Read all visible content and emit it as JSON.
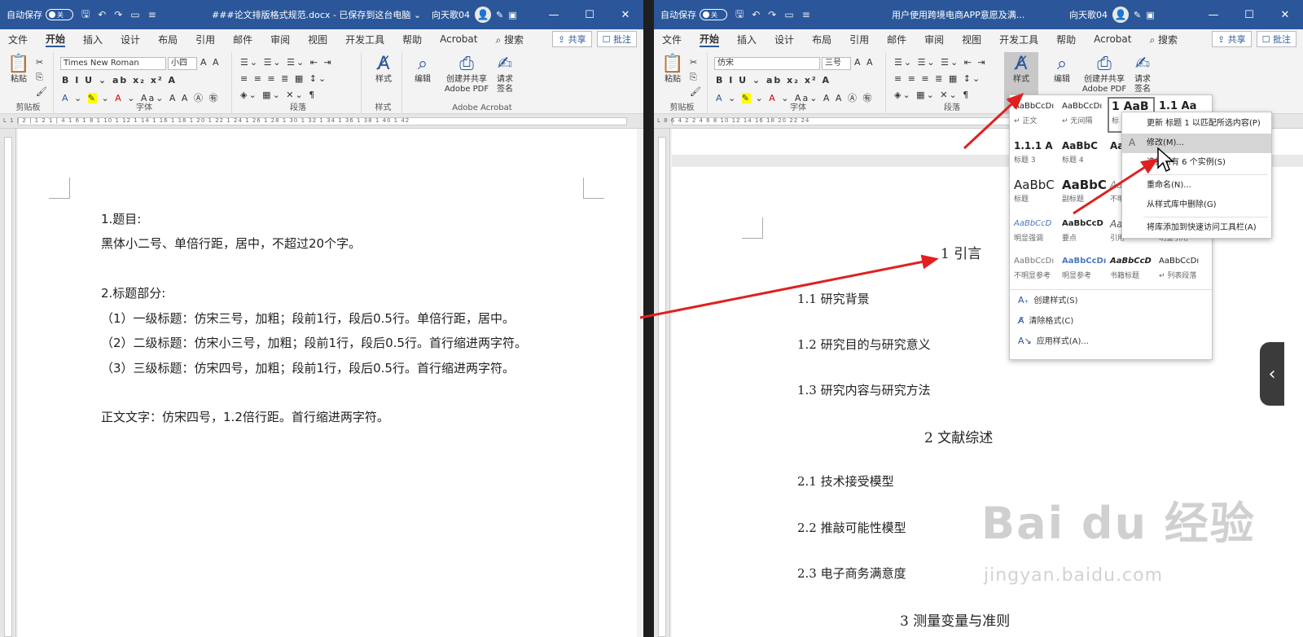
{
  "left_window": {
    "autosave_label": "自动保存",
    "autosave_state": "关",
    "doc_title": "###论文排版格式规范.docx - 已保存到这台电脑 ⌄",
    "user_name": "向天歌04",
    "tabs": [
      "文件",
      "开始",
      "插入",
      "设计",
      "布局",
      "引用",
      "邮件",
      "审阅",
      "视图",
      "开发工具",
      "帮助",
      "Acrobat",
      "⌕ 搜索"
    ],
    "share_label": "⇪ 共享",
    "comment_label": "☐ 批注",
    "ribbon": {
      "paste_label": "粘贴",
      "clipboard_label": "剪贴板",
      "font_name": "Times New Roman",
      "font_size": "小四",
      "font_label": "字体",
      "paragraph_label": "段落",
      "styles_btn_label": "样式",
      "styles_group_label": "样式",
      "edit_label": "编辑",
      "pdf_label": "创建并共享 Adobe PDF",
      "sign_label": "请求 签名",
      "acrobat_group_label": "Adobe Acrobat"
    },
    "ruler_marks": "L  1 | 2 | 1   2   1 | 4   1 6   1 8   1 10   1 12   1 14   1 16   1 18   1 20   1 22   1 24   1 26   1 28   1 30   1 32   1 34   1 36   1 38   1 40   1 42",
    "content": [
      "1.题目:",
      "黑体小二号、单倍行距，居中，不超过20个字。",
      "2.标题部分:",
      "（1）一级标题：仿宋三号，加粗；段前1行，段后0.5行。单倍行距，居中。",
      "（2）二级标题：仿宋小三号，加粗；段前1行，段后0.5行。首行缩进两字符。",
      "（3）三级标题：仿宋四号，加粗；段前1行，段后0.5行。首行缩进两字符。",
      "正文文字：仿宋四号，1.2倍行距。首行缩进两字符。"
    ]
  },
  "right_window": {
    "autosave_label": "自动保存",
    "autosave_state": "关",
    "doc_title": "用户使用跨境电商APP意愿及满...",
    "user_name": "向天歌04",
    "tabs": [
      "文件",
      "开始",
      "插入",
      "设计",
      "布局",
      "引用",
      "邮件",
      "审阅",
      "视图",
      "开发工具",
      "帮助",
      "Acrobat",
      "⌕ 搜索"
    ],
    "share_label": "⇪ 共享",
    "comment_label": "☐ 批注",
    "ribbon": {
      "paste_label": "粘贴",
      "clipboard_label": "剪贴板",
      "font_name": "仿宋",
      "font_size": "三号",
      "font_label": "字体",
      "paragraph_label": "段落",
      "styles_btn_label": "样式",
      "edit_label": "编辑",
      "pdf_label": "创建并共享 Adobe PDF",
      "sign_label": "请求 签名"
    },
    "ruler_marks": "L     8   6   4   2         2   4   6   8   10   12   14   16   18   20   22   24",
    "headings": [
      {
        "text": "1 引言",
        "level": 1
      },
      {
        "text": "1.1 研究背景",
        "level": 2
      },
      {
        "text": "1.2 研究目的与研究意义",
        "level": 2
      },
      {
        "text": "1.3 研究内容与研究方法",
        "level": 2
      },
      {
        "text": "2 文献综述",
        "level": 1
      },
      {
        "text": "2.1 技术接受模型",
        "level": 2
      },
      {
        "text": "2.2 推敲可能性模型",
        "level": 2
      },
      {
        "text": "2.3 电子商务满意度",
        "level": 2
      },
      {
        "text": "3 测量变量与准则",
        "level": 1
      }
    ],
    "styles_gallery": {
      "cells": [
        {
          "preview": "AaBbCcDı",
          "name": "↵ 正文"
        },
        {
          "preview": "AaBbCcDı",
          "name": "↵ 无间隔"
        },
        {
          "preview": "1  AaB",
          "name": "标"
        },
        {
          "preview": "1.1  Aa",
          "name": ""
        },
        {
          "preview": "1.1.1  A",
          "name": "标题 3"
        },
        {
          "preview": "AaBbC",
          "name": "标题 4"
        },
        {
          "preview": "Aa",
          "name": ""
        },
        {
          "preview": "",
          "name": ""
        },
        {
          "preview": "AaBbC",
          "name": "标题"
        },
        {
          "preview": "AaBbC",
          "name": "副标题"
        },
        {
          "preview": "Aa",
          "name": "不明"
        },
        {
          "preview": "",
          "name": ""
        },
        {
          "preview": "AaBbCcD",
          "name": "明显强调"
        },
        {
          "preview": "AaBbCcD",
          "name": "要点"
        },
        {
          "preview": "Aa",
          "name": "引用"
        },
        {
          "preview": "",
          "name": "明显引用"
        },
        {
          "preview": "AaBbCcDı",
          "name": "不明显参考"
        },
        {
          "preview": "AaBbCcDı",
          "name": "明显参考"
        },
        {
          "preview": "AaBbCcD",
          "name": "书籍标题"
        },
        {
          "preview": "AaBbCcDı",
          "name": "↵ 列表段落"
        }
      ],
      "actions": [
        {
          "icon": "A₊",
          "label": "创建样式(S)"
        },
        {
          "icon": "A̸",
          "label": "清除格式(C)"
        },
        {
          "icon": "A↘",
          "label": "应用样式(A)..."
        }
      ]
    },
    "context_menu": [
      "更新 标题 1 以匹配所选内容(P)",
      "修改(M)...",
      "选择所有 6 个实例(S)",
      "重命名(N)...",
      "从样式库中删除(G)",
      "将库添加到快速访问工具栏(A)"
    ]
  },
  "watermark": {
    "main": "Bai du 经验",
    "sub": "jingyan.baidu.com"
  },
  "colors": {
    "title_bar": "#2b579a",
    "arrow": "#e02020",
    "highlight": "#d5d5d5"
  }
}
